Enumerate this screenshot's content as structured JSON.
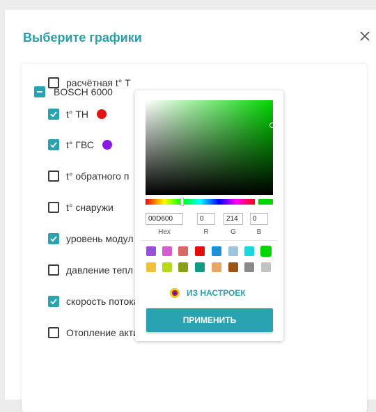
{
  "dialog": {
    "title": "Выберите графики"
  },
  "group": {
    "label": "BOSCH 6000",
    "state": "mixed"
  },
  "rows": [
    {
      "label": "расчётная t° Т",
      "checked": false,
      "dot": null
    },
    {
      "label": "t° ТН",
      "checked": true,
      "dot": "#e51414"
    },
    {
      "label": "t° ГВС",
      "checked": true,
      "dot": "#8b17e8"
    },
    {
      "label": "t° обратного п",
      "checked": false,
      "dot": null
    },
    {
      "label": "t° снаружи",
      "checked": false,
      "dot": null
    },
    {
      "label": "уровень модул",
      "checked": true,
      "dot": null
    },
    {
      "label": "давление тепл",
      "checked": false,
      "dot": null
    },
    {
      "label": "скорость потока ГВС",
      "checked": true,
      "dot": "#10c810"
    },
    {
      "label": "Отопление активно",
      "checked": false,
      "dot": "gradient"
    }
  ],
  "picker": {
    "hex": "00D600",
    "r": "0",
    "g": "214",
    "b": "0",
    "labels": {
      "hex": "Hex",
      "r": "R",
      "g": "G",
      "b": "B"
    },
    "selected_color": "#00d600",
    "swatches_row1": [
      "#9b4fd8",
      "#d95bd0",
      "#d66a6a",
      "#e20e0e",
      "#1e90d8",
      "#9bc6dc",
      "#18d8e0",
      "#00d600"
    ],
    "swatches_row2": [
      "#efc23a",
      "#b8d81a",
      "#88a018",
      "#109a86",
      "#e8a66a",
      "#9c5414",
      "#8a8a8a",
      "#c2c2c2"
    ],
    "settings_label": "ИЗ НАСТРОЕК",
    "apply_label": "ПРИМЕНИТЬ"
  }
}
